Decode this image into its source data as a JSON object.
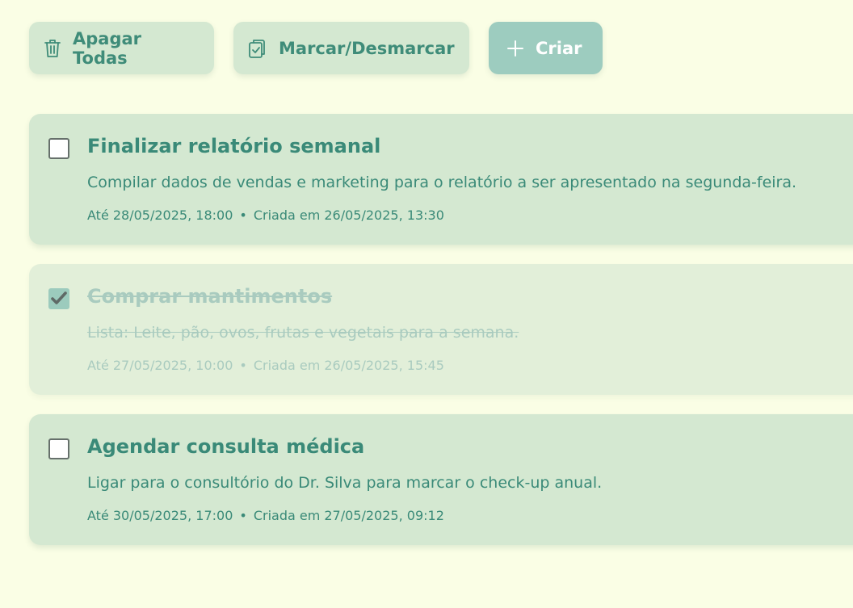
{
  "toolbar": {
    "delete_all": {
      "label": "Apagar Todas",
      "icon": "trash-icon"
    },
    "toggle_all": {
      "label": "Marcar/Desmarcar",
      "icon": "clipboard-check-icon"
    },
    "create": {
      "label": "Criar",
      "icon": "plus-icon"
    }
  },
  "colors": {
    "background": "#fafee5",
    "card": "#d4e8d1",
    "card_done": "#e2efd9",
    "accent": "#3a8a78",
    "create_button": "#9dccbf",
    "checkbox_checked": "#9ccbbd"
  },
  "tasks": [
    {
      "title": "Finalizar relatório semanal",
      "description": "Compilar dados de vendas e marketing para o relatório a ser apresentado na segunda-feira.",
      "due": "Até 28/05/2025, 18:00",
      "separator": "•",
      "created": "Criada em 26/05/2025, 13:30",
      "completed": false
    },
    {
      "title": "Comprar mantimentos",
      "description": "Lista: Leite, pão, ovos, frutas e vegetais para a semana.",
      "due": "Até 27/05/2025, 10:00",
      "separator": "•",
      "created": "Criada em 26/05/2025, 15:45",
      "completed": true
    },
    {
      "title": "Agendar consulta médica",
      "description": "Ligar para o consultório do Dr. Silva para marcar o check-up anual.",
      "due": "Até 30/05/2025, 17:00",
      "separator": "•",
      "created": "Criada em 27/05/2025, 09:12",
      "completed": false
    }
  ]
}
